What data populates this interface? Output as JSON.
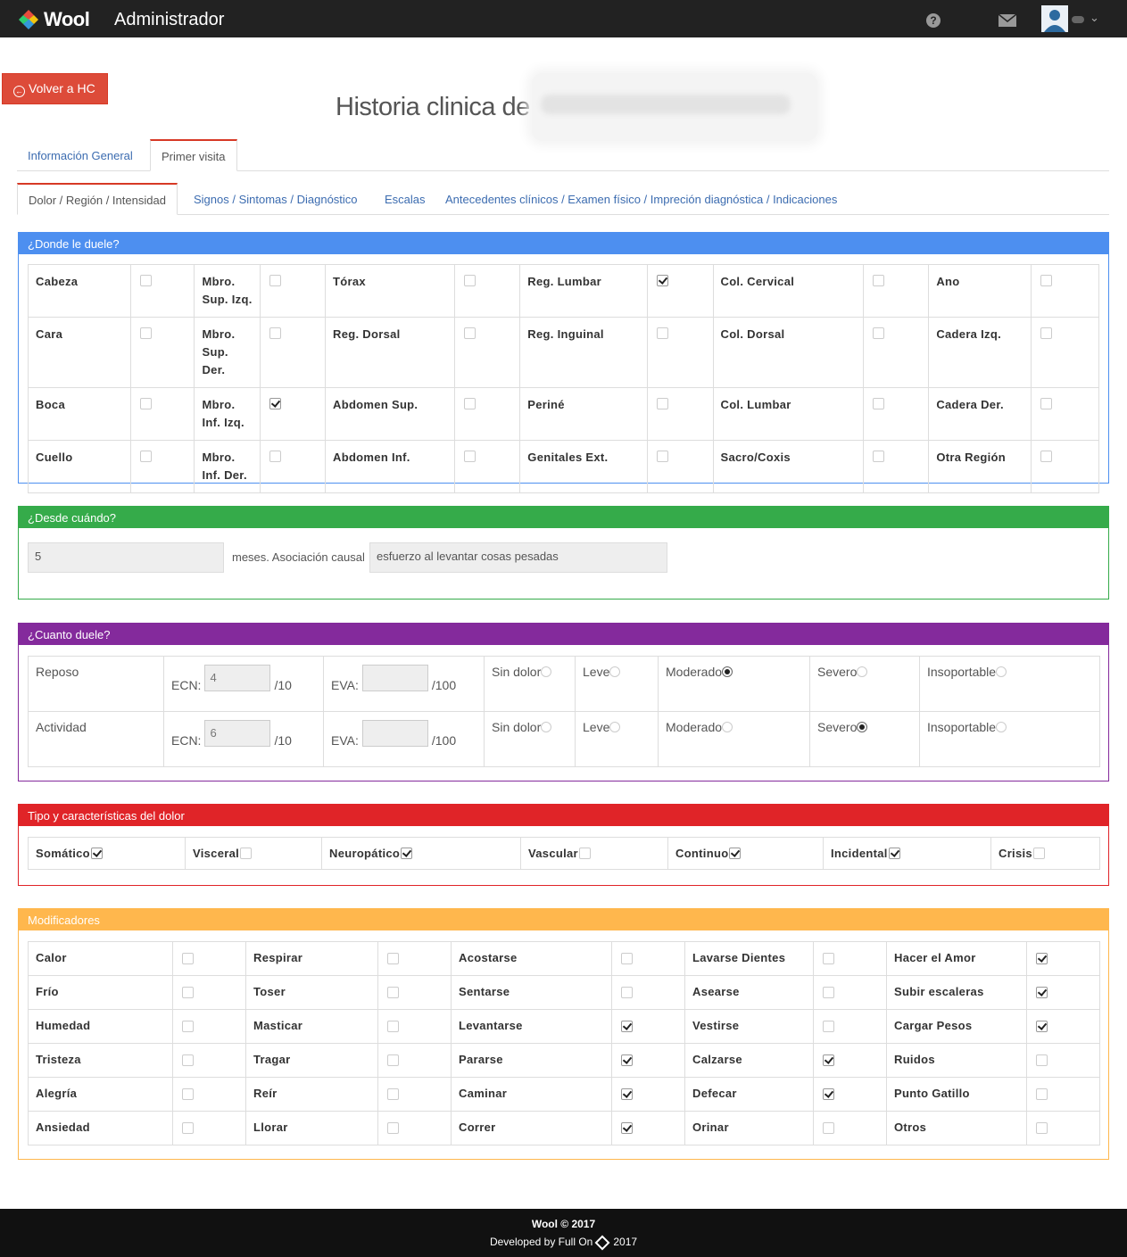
{
  "header": {
    "brand": "Wool",
    "section": "Administrador"
  },
  "back_label": "Volver a HC",
  "page_title": "Historia clinica de",
  "tabs_main": [
    "Información General",
    "Primer visita"
  ],
  "tabs_sub": [
    "Dolor / Región / Intensidad",
    "Signos / Sintomas / Diagnóstico",
    "Escalas",
    "Antecedentes clínicos / Examen físico / Impreción diagnóstica / Indicaciones"
  ],
  "colors": {
    "blue": "#4d8ff0",
    "green": "#35ab4a",
    "purple": "#842a9c",
    "red": "#e02428",
    "orange": "#ffb74d",
    "danger_button": "#dd4b39"
  },
  "donde": {
    "title": "¿Donde le duele?",
    "rows": [
      [
        {
          "l": "Cabeza",
          "c": false
        },
        {
          "l": "Mbro. Sup. Izq.",
          "c": false
        },
        {
          "l": "Tórax",
          "c": false
        },
        {
          "l": "Reg. Lumbar",
          "c": true
        },
        {
          "l": "Col. Cervical",
          "c": false
        },
        {
          "l": "Ano",
          "c": false
        }
      ],
      [
        {
          "l": "Cara",
          "c": false
        },
        {
          "l": "Mbro. Sup. Der.",
          "c": false
        },
        {
          "l": "Reg. Dorsal",
          "c": false
        },
        {
          "l": "Reg. Inguinal",
          "c": false
        },
        {
          "l": "Col. Dorsal",
          "c": false
        },
        {
          "l": "Cadera Izq.",
          "c": false
        }
      ],
      [
        {
          "l": "Boca",
          "c": false
        },
        {
          "l": "Mbro. Inf. Izq.",
          "c": true
        },
        {
          "l": "Abdomen Sup.",
          "c": false
        },
        {
          "l": "Periné",
          "c": false
        },
        {
          "l": "Col. Lumbar",
          "c": false
        },
        {
          "l": "Cadera Der.",
          "c": false
        }
      ],
      [
        {
          "l": "Cuello",
          "c": false
        },
        {
          "l": "Mbro. Inf. Der.",
          "c": false
        },
        {
          "l": "Abdomen Inf.",
          "c": false
        },
        {
          "l": "Genitales Ext.",
          "c": false
        },
        {
          "l": "Sacro/Coxis",
          "c": false
        },
        {
          "l": "Otra Región",
          "c": false
        }
      ]
    ]
  },
  "desde": {
    "title": "¿Desde cuándo?",
    "value": "5",
    "mid_label": "meses. Asociación causal",
    "cause": "esfuerzo al levantar cosas pesadas"
  },
  "cuanto": {
    "title": "¿Cuanto duele?",
    "ecn_label": "ECN:",
    "ecn_suffix": "/10",
    "eva_label": "EVA:",
    "eva_suffix": "/100",
    "options": [
      "Sin dolor",
      "Leve",
      "Moderado",
      "Severo",
      "Insoportable"
    ],
    "rows": [
      {
        "label": "Reposo",
        "ecn": "4",
        "eva": "",
        "selected": "Moderado"
      },
      {
        "label": "Actividad",
        "ecn": "6",
        "eva": "",
        "selected": "Severo"
      }
    ]
  },
  "tipo": {
    "title": "Tipo y características del dolor",
    "items": [
      {
        "l": "Somático",
        "c": true
      },
      {
        "l": "Visceral",
        "c": false
      },
      {
        "l": "Neuropático",
        "c": true
      },
      {
        "l": "Vascular",
        "c": false
      },
      {
        "l": "Continuo",
        "c": true
      },
      {
        "l": "Incidental",
        "c": true
      },
      {
        "l": "Crisis",
        "c": false
      }
    ]
  },
  "modificadores": {
    "title": "Modificadores",
    "rows": [
      [
        {
          "l": "Calor",
          "c": false
        },
        {
          "l": "Respirar",
          "c": false
        },
        {
          "l": "Acostarse",
          "c": false
        },
        {
          "l": "Lavarse Dientes",
          "c": false
        },
        {
          "l": "Hacer el Amor",
          "c": true
        }
      ],
      [
        {
          "l": "Frío",
          "c": false
        },
        {
          "l": "Toser",
          "c": false
        },
        {
          "l": "Sentarse",
          "c": false
        },
        {
          "l": "Asearse",
          "c": false
        },
        {
          "l": "Subir escaleras",
          "c": true
        }
      ],
      [
        {
          "l": "Humedad",
          "c": false
        },
        {
          "l": "Masticar",
          "c": false
        },
        {
          "l": "Levantarse",
          "c": true
        },
        {
          "l": "Vestirse",
          "c": false
        },
        {
          "l": "Cargar Pesos",
          "c": true
        }
      ],
      [
        {
          "l": "Tristeza",
          "c": false
        },
        {
          "l": "Tragar",
          "c": false
        },
        {
          "l": "Pararse",
          "c": true
        },
        {
          "l": "Calzarse",
          "c": true
        },
        {
          "l": "Ruidos",
          "c": false
        }
      ],
      [
        {
          "l": "Alegría",
          "c": false
        },
        {
          "l": "Reír",
          "c": false
        },
        {
          "l": "Caminar",
          "c": true
        },
        {
          "l": "Defecar",
          "c": true
        },
        {
          "l": "Punto Gatillo",
          "c": false
        }
      ],
      [
        {
          "l": "Ansiedad",
          "c": false
        },
        {
          "l": "Llorar",
          "c": false
        },
        {
          "l": "Correr",
          "c": true
        },
        {
          "l": "Orinar",
          "c": false
        },
        {
          "l": "Otros",
          "c": false
        }
      ]
    ]
  },
  "footer": {
    "line1": "Wool © 2017",
    "line2_prefix": "Developed by Full On",
    "line2_suffix": "2017"
  }
}
